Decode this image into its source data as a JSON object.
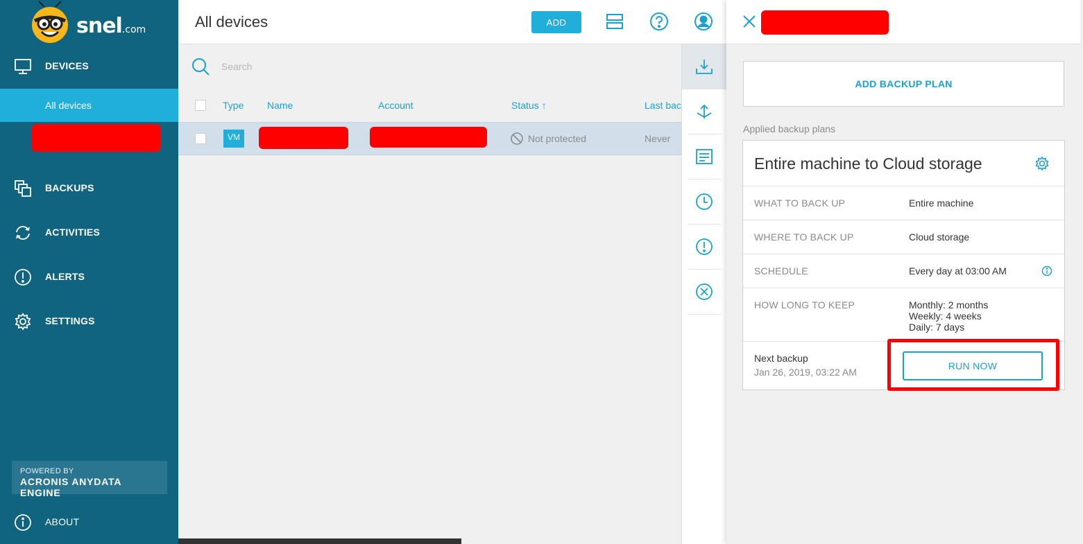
{
  "brand": {
    "name": "snel",
    "suffix": ".com",
    "logo_icon": "bee-mascot-icon"
  },
  "sidebar": {
    "items": [
      {
        "label": "DEVICES",
        "icon": "monitor-icon"
      },
      {
        "label": "BACKUPS",
        "icon": "copies-icon"
      },
      {
        "label": "ACTIVITIES",
        "icon": "sync-icon"
      },
      {
        "label": "ALERTS",
        "icon": "alert-icon"
      },
      {
        "label": "SETTINGS",
        "icon": "gear-icon"
      }
    ],
    "sub_items": [
      {
        "label": "All devices",
        "active": true
      }
    ],
    "powered_by": {
      "line1": "POWERED BY",
      "line2": "ACRONIS ANYDATA ENGINE"
    },
    "about": {
      "label": "ABOUT",
      "icon": "info-icon"
    }
  },
  "header": {
    "title": "All devices",
    "add_label": "ADD",
    "icons": [
      "layout-icon",
      "help-icon",
      "user-icon"
    ]
  },
  "search": {
    "placeholder": "Search"
  },
  "table": {
    "columns": [
      "Type",
      "Name",
      "Account",
      "Status",
      "Last bac"
    ],
    "sort_indicator": "↑",
    "rows": [
      {
        "type": "VM",
        "status": "Not protected",
        "last_backup": "Never"
      }
    ]
  },
  "rail": [
    "backup-icon",
    "recovery-icon",
    "details-icon",
    "history-icon",
    "alert-icon",
    "close-circle-icon"
  ],
  "panel": {
    "add_plan_label": "ADD BACKUP PLAN",
    "applied_label": "Applied backup plans",
    "plan": {
      "title": "Entire machine to Cloud storage",
      "rows": [
        {
          "key": "WHAT TO BACK UP",
          "value": "Entire machine"
        },
        {
          "key": "WHERE TO BACK UP",
          "value": "Cloud storage"
        },
        {
          "key": "SCHEDULE",
          "value": "Every day at 03:00 AM"
        },
        {
          "key": "HOW LONG TO KEEP",
          "values": [
            "Monthly: 2 months",
            "Weekly: 4 weeks",
            "Daily: 7 days"
          ]
        }
      ],
      "next_backup_label": "Next backup",
      "next_backup_value": "Jan 26, 2019, 03:22 AM",
      "run_now_label": "RUN NOW"
    }
  },
  "colors": {
    "sidebar": "#10647f",
    "accent": "#20aedb",
    "redaction": "#ff0000"
  }
}
